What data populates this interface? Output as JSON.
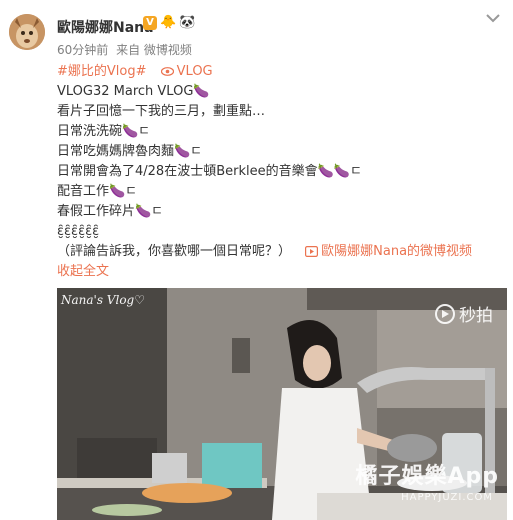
{
  "user": {
    "name": "歐陽娜娜Nana",
    "verified_badge": "V",
    "badge_emojis": [
      "🐥",
      "🐼"
    ],
    "timestamp": "60分钟前",
    "source": "来自 微博视频"
  },
  "post": {
    "topic": "#娜比的Vlog#",
    "vlog_tag": "VLOG",
    "lines": [
      "VLOG32 March VLOG🍆",
      "看片子回憶一下我的三月，劃重點…",
      "日常洗洗碗🍆ㄷ",
      "日常吃媽媽牌魯肉麵🍆ㄷ",
      "日常開會為了4/28在波士頓Berklee的音樂會🍆🍆ㄷ",
      "配音工作🍆ㄷ",
      "春假工作碎片🍆ㄷ",
      "ԑ̮̑ԑ̮̑ԑ̮̑ԑ̮̑ԑ̮̑ԑ̮̑"
    ],
    "question": "（評論告訴我，你喜歡哪一個日常呢？）",
    "video_link": "歐陽娜娜Nana的微博视频",
    "collapse": "收起全文"
  },
  "video": {
    "handwriting": "Nana's Vlog♡",
    "miaopai_watermark": "秒拍",
    "site_watermark": "橘子娛樂App",
    "site_url": "HAPPYJUZI.COM"
  },
  "colors": {
    "accent": "#eb7350",
    "text": "#333333",
    "meta": "#808080"
  },
  "icons": [
    "avatar-image",
    "verified-v-icon",
    "chevron-down-icon",
    "video-link-icon",
    "play-icon"
  ]
}
